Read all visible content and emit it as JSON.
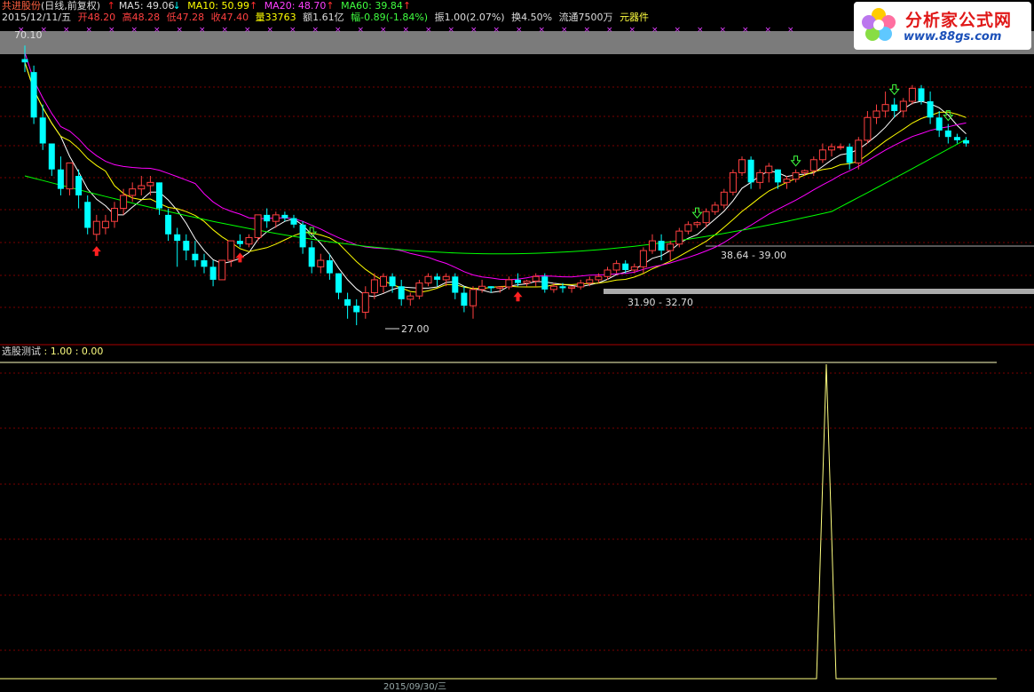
{
  "header": {
    "stock_name": "共进股份",
    "period": "(日线,前复权)",
    "ma5": "MA5: 49.06",
    "ma10": "MA10: 50.99",
    "ma20": "MA20: 48.70",
    "ma60": "MA60: 39.84",
    "arrow_up": "↑",
    "arrow_down": "↓",
    "date": "2015/12/11/五",
    "open": "开48.20",
    "high": "高48.28",
    "low": "低47.28",
    "close": "收47.40",
    "volume": "量33763",
    "amount": "额1.61亿",
    "change": "幅-0.89(-1.84%)",
    "amplitude": "振1.00(2.07%)",
    "turnover": "换4.50%",
    "float": "流通7500万",
    "sector": "元器件"
  },
  "colors": {
    "ma5": "#ffffff",
    "ma10": "#ffff00",
    "ma20": "#ff00ff",
    "ma60": "#00ff00",
    "up": "#ff4040",
    "down": "#00ffff",
    "grid": "#7a0000"
  },
  "price_labels": {
    "top": "70.10",
    "low": "27.00",
    "zone1": "31.90 - 32.70",
    "zone2": "38.64 - 39.00"
  },
  "sub_chart": {
    "title": "选股测试",
    "values": ": 1.00 : 0.00"
  },
  "logo": {
    "title": "分析家公式网",
    "url": "www.88gs.com"
  },
  "bottom_date": "2015/09/30/三",
  "icons": {
    "signal_up": "red-up-arrow-icon",
    "signal_down": "green-down-arrow-icon"
  },
  "chart_data": {
    "type": "candlestick",
    "candles": [
      [
        68,
        70.1,
        66,
        67.5
      ],
      [
        66,
        67,
        58,
        59
      ],
      [
        59,
        61,
        54,
        55
      ],
      [
        55,
        55,
        50,
        51
      ],
      [
        51,
        53,
        47,
        48
      ],
      [
        48,
        52,
        47,
        52
      ],
      [
        50,
        51,
        45,
        47
      ],
      [
        46,
        47,
        41,
        42
      ],
      [
        41,
        44,
        40,
        43
      ],
      [
        42,
        44,
        41,
        43
      ],
      [
        43,
        46,
        42,
        45
      ],
      [
        45,
        48,
        44,
        47
      ],
      [
        47,
        49,
        46,
        48
      ],
      [
        48,
        50,
        47,
        48.5
      ],
      [
        48.5,
        50,
        47,
        49
      ],
      [
        49,
        49,
        44,
        45
      ],
      [
        44,
        45,
        40,
        41
      ],
      [
        41,
        42,
        36,
        40
      ],
      [
        40,
        41,
        37,
        38.5
      ],
      [
        38,
        40,
        36,
        37
      ],
      [
        37,
        38,
        35,
        36
      ],
      [
        36,
        37,
        33,
        34
      ],
      [
        34,
        37,
        34,
        37
      ],
      [
        37,
        40,
        36,
        40
      ],
      [
        40,
        41,
        39,
        39.5
      ],
      [
        39.5,
        41,
        39,
        40.5
      ],
      [
        40.5,
        44,
        40,
        44
      ],
      [
        44,
        45,
        42,
        43
      ],
      [
        43,
        44.5,
        42,
        44
      ],
      [
        44,
        44.5,
        43,
        43.5
      ],
      [
        43.5,
        44,
        42,
        42.5
      ],
      [
        42.5,
        43,
        38,
        39
      ],
      [
        39,
        40,
        35,
        36
      ],
      [
        36,
        38,
        35,
        37
      ],
      [
        37,
        38,
        34,
        35
      ],
      [
        35,
        35,
        31,
        32
      ],
      [
        31,
        32,
        28,
        30
      ],
      [
        30,
        31,
        27,
        29
      ],
      [
        29,
        33,
        28,
        32
      ],
      [
        32,
        35,
        31,
        34
      ],
      [
        33,
        35,
        32,
        34.5
      ],
      [
        34.5,
        35,
        32,
        33
      ],
      [
        33,
        34,
        30,
        31
      ],
      [
        31,
        32,
        30,
        31.5
      ],
      [
        31.5,
        34,
        31,
        33.5
      ],
      [
        33.5,
        35,
        33,
        34.5
      ],
      [
        34.5,
        35,
        33,
        34
      ],
      [
        34,
        35,
        33,
        34.5
      ],
      [
        34.5,
        35,
        31,
        32
      ],
      [
        32,
        33,
        29,
        30
      ],
      [
        30,
        33,
        28,
        32.5
      ],
      [
        32.5,
        34,
        32,
        33
      ],
      [
        33,
        33,
        32,
        32.7
      ],
      [
        32.7,
        33,
        32,
        32.9
      ],
      [
        32.9,
        34.5,
        32.5,
        34
      ],
      [
        34,
        35,
        33,
        33.5
      ],
      [
        33.5,
        34,
        33,
        33.8
      ],
      [
        33.8,
        35,
        33,
        34.5
      ],
      [
        34.5,
        35,
        32,
        32.5
      ],
      [
        32.5,
        33.5,
        32,
        33
      ],
      [
        33,
        33.5,
        32,
        32.7
      ],
      [
        32.7,
        33,
        32,
        32.9
      ],
      [
        32.9,
        34,
        32.5,
        33.5
      ],
      [
        33.5,
        34.5,
        33,
        34
      ],
      [
        34,
        35,
        33.5,
        34.5
      ],
      [
        34.5,
        36,
        34,
        35.5
      ],
      [
        35.5,
        37,
        35,
        36.5
      ],
      [
        36.5,
        37,
        35,
        35.5
      ],
      [
        35.5,
        36.5,
        35,
        36
      ],
      [
        36,
        39,
        35,
        38.5
      ],
      [
        38.5,
        41,
        38,
        40
      ],
      [
        40,
        41,
        37,
        38.5
      ],
      [
        38.5,
        40,
        37,
        39.5
      ],
      [
        39.5,
        42,
        39,
        41.5
      ],
      [
        41.5,
        43,
        41,
        42.5
      ],
      [
        42.5,
        43,
        42,
        42.8
      ],
      [
        42.8,
        45,
        42,
        44.5
      ],
      [
        44.5,
        46,
        44,
        45.5
      ],
      [
        45.5,
        48,
        45,
        47.5
      ],
      [
        47.5,
        51,
        47,
        50.5
      ],
      [
        50.5,
        53,
        50,
        52.5
      ],
      [
        52.5,
        53,
        48,
        49
      ],
      [
        49,
        51,
        48,
        50.5
      ],
      [
        50.5,
        52,
        49,
        51.5
      ],
      [
        51,
        51,
        48,
        49
      ],
      [
        49,
        50,
        48,
        49.5
      ],
      [
        49.5,
        51,
        49,
        50.5
      ],
      [
        50.5,
        51,
        50,
        50.8
      ],
      [
        50.8,
        53,
        50,
        52.5
      ],
      [
        52.5,
        55,
        52,
        54
      ],
      [
        54,
        55,
        53,
        54.5
      ],
      [
        54.5,
        55,
        54,
        54.5
      ],
      [
        54.5,
        55,
        51,
        52
      ],
      [
        52,
        56,
        51,
        55.5
      ],
      [
        55.5,
        60,
        55,
        59
      ],
      [
        59,
        61,
        58,
        60
      ],
      [
        60,
        63,
        59,
        61
      ],
      [
        61,
        62,
        59,
        60
      ],
      [
        60,
        62,
        59,
        61.5
      ],
      [
        61.5,
        64,
        61,
        63.5
      ],
      [
        63.5,
        64,
        61,
        61.5
      ],
      [
        61.5,
        63,
        58,
        59
      ],
      [
        59,
        60,
        56,
        57
      ],
      [
        57,
        58,
        55,
        56
      ],
      [
        56,
        56.5,
        55,
        55.5
      ],
      [
        55.5,
        56,
        54.5,
        55
      ]
    ]
  }
}
